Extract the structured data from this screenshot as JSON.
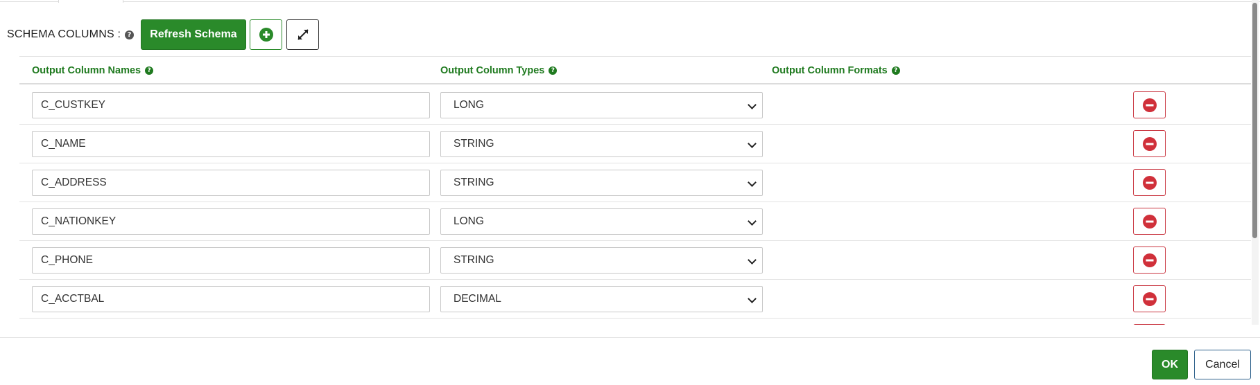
{
  "toolbar": {
    "schema_label": "SCHEMA COLUMNS :",
    "refresh_label": "Refresh Schema",
    "add_icon": "plus-circle-icon",
    "expand_icon": "expand-arrows-icon"
  },
  "table": {
    "headers": {
      "names": "Output Column Names",
      "types": "Output Column Types",
      "formats": "Output Column Formats"
    },
    "rows": [
      {
        "name": "C_CUSTKEY",
        "type": "LONG",
        "format": ""
      },
      {
        "name": "C_NAME",
        "type": "STRING",
        "format": ""
      },
      {
        "name": "C_ADDRESS",
        "type": "STRING",
        "format": ""
      },
      {
        "name": "C_NATIONKEY",
        "type": "LONG",
        "format": ""
      },
      {
        "name": "C_PHONE",
        "type": "STRING",
        "format": ""
      },
      {
        "name": "C_ACCTBAL",
        "type": "DECIMAL",
        "format": ""
      },
      {
        "name": "",
        "type": "",
        "format": ""
      }
    ]
  },
  "footer": {
    "ok_label": "OK",
    "cancel_label": "Cancel"
  },
  "colors": {
    "accent_green": "#2a8a2a",
    "header_green": "#1f7a1f",
    "danger_red": "#d0303a"
  }
}
